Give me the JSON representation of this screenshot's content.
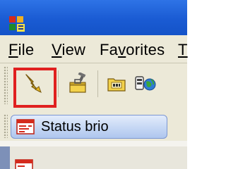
{
  "window": {
    "app_icon": "app-window-icon"
  },
  "menubar": {
    "items": [
      {
        "label_first": "F",
        "label_rest": "ile"
      },
      {
        "label_first": "V",
        "label_rest": "iew"
      },
      {
        "label_first": "F",
        "label_rest": "a",
        "label_underlined": "v",
        "label_tail": "orites"
      },
      {
        "label_first": "T"
      }
    ]
  },
  "toolbar": {
    "buttons": [
      {
        "icon": "lightning-bolt-icon",
        "highlighted": true
      },
      {
        "icon": "toolbox-icon"
      },
      {
        "icon": "folder-icon"
      },
      {
        "icon": "network-globe-icon"
      }
    ],
    "highlight_color": "#e02020"
  },
  "status_button": {
    "label": "Status brio",
    "icon": "status-window-icon"
  },
  "colors": {
    "titlebar": "#2466dc",
    "chrome": "#ece9d8",
    "button_face": "#c5d7f4"
  }
}
